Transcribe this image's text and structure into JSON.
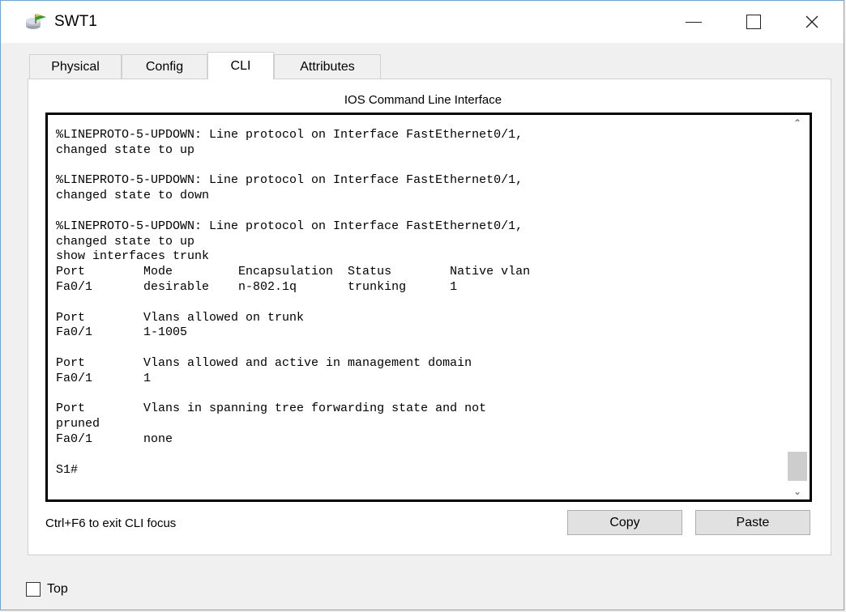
{
  "window": {
    "title": "SWT1"
  },
  "tabs": [
    {
      "label": "Physical"
    },
    {
      "label": "Config"
    },
    {
      "label": "CLI"
    },
    {
      "label": "Attributes"
    }
  ],
  "active_tab": "CLI",
  "cli": {
    "heading": "IOS Command Line Interface",
    "output_lines": [
      "%LINEPROTO-5-UPDOWN: Line protocol on Interface FastEthernet0/1,",
      "changed state to up",
      "",
      "%LINEPROTO-5-UPDOWN: Line protocol on Interface FastEthernet0/1,",
      "changed state to down",
      "",
      "%LINEPROTO-5-UPDOWN: Line protocol on Interface FastEthernet0/1,",
      "changed state to up",
      "show interfaces trunk",
      "Port        Mode         Encapsulation  Status        Native vlan",
      "Fa0/1       desirable    n-802.1q       trunking      1",
      "",
      "Port        Vlans allowed on trunk",
      "Fa0/1       1-1005",
      "",
      "Port        Vlans allowed and active in management domain",
      "Fa0/1       1",
      "",
      "Port        Vlans in spanning tree forwarding state and not",
      "pruned",
      "Fa0/1       none",
      "",
      "S1#"
    ],
    "exit_hint": "Ctrl+F6 to exit CLI focus",
    "copy_label": "Copy",
    "paste_label": "Paste"
  },
  "footer": {
    "top_label": "Top",
    "top_checked": false
  },
  "icons": {
    "app": "packet-tracer-switch-icon",
    "minimize": "minimize-icon",
    "maximize": "maximize-icon",
    "close": "close-icon",
    "scroll_up": "chevron-up-icon",
    "scroll_down": "chevron-down-icon"
  }
}
